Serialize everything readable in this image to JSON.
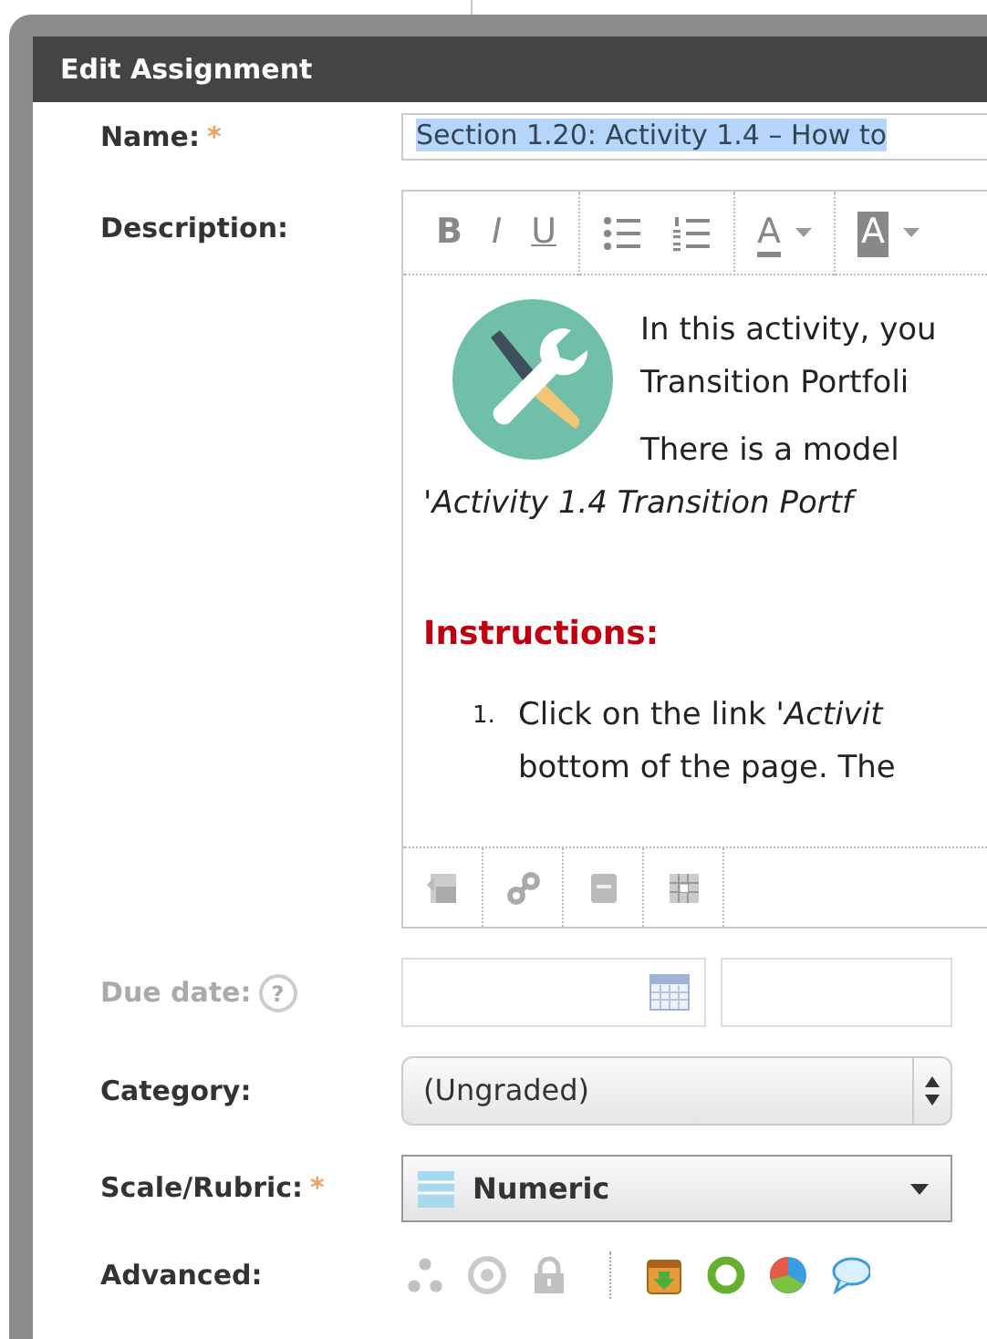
{
  "dialog": {
    "title": "Edit Assignment"
  },
  "form": {
    "name": {
      "label": "Name:",
      "required_mark": "*",
      "value": "Section 1.20: Activity 1.4 – How to",
      "highlighted": true
    },
    "description": {
      "label": "Description:",
      "toolbar": [
        {
          "kind": "bold",
          "label": "B"
        },
        {
          "kind": "italic",
          "label": "I"
        },
        {
          "kind": "underline",
          "label": "U"
        },
        {
          "kind": "separator"
        },
        {
          "kind": "bullets"
        },
        {
          "kind": "numbers"
        },
        {
          "kind": "separator"
        },
        {
          "kind": "text-color",
          "label": "A",
          "has_menu": true
        },
        {
          "kind": "separator"
        },
        {
          "kind": "highlight",
          "label": "A",
          "has_menu": true
        }
      ],
      "intro_lines": [
        "In this activity, you",
        "Transition Portfoli"
      ],
      "model_lines": [
        "There is a model",
        "'*Activity 1.4 Transition Portf*"
      ],
      "heading": "Instructions:",
      "steps": [
        {
          "number": "1.",
          "lines": [
            "Click on the link '*Activit*",
            "bottom of the page. The"
          ]
        }
      ],
      "bottom_toolbar": [
        {
          "kind": "image"
        },
        {
          "kind": "link"
        },
        {
          "kind": "embed"
        },
        {
          "kind": "table"
        }
      ]
    },
    "due_date": {
      "label": "Due date:",
      "disabled": true,
      "help": "?"
    },
    "category": {
      "label": "Category:",
      "value": "(Ungraded)"
    },
    "scale": {
      "label": "Scale/Rubric:",
      "required_mark": "*",
      "value": "Numeric"
    },
    "advanced": {
      "label": "Advanced:",
      "tools": [
        {
          "kind": "dots",
          "disabled": true
        },
        {
          "kind": "target",
          "disabled": true
        },
        {
          "kind": "lock",
          "disabled": true
        },
        {
          "kind": "separator"
        },
        {
          "kind": "download-box",
          "disabled": false
        },
        {
          "kind": "ring",
          "disabled": false
        },
        {
          "kind": "pie",
          "disabled": false
        },
        {
          "kind": "speech",
          "disabled": false
        }
      ]
    }
  }
}
